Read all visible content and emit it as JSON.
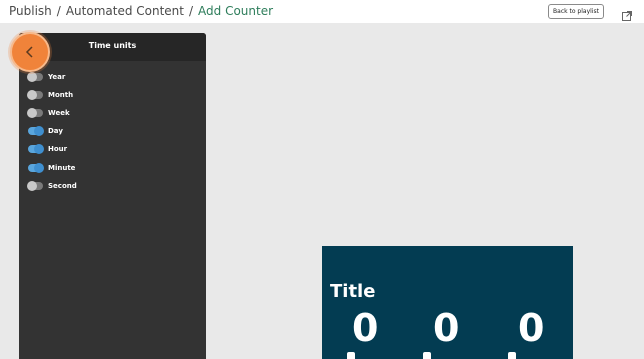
{
  "breadcrumb": {
    "items": [
      "Publish",
      "Automated Content",
      "Add Counter"
    ],
    "separator": "/"
  },
  "header": {
    "back_to_playlist": "Back to playlist",
    "window_icon": "external-window-icon"
  },
  "panel": {
    "title": "Time units",
    "back_icon": "chevron-left-icon",
    "toggles": [
      {
        "label": "Year",
        "on": false
      },
      {
        "label": "Month",
        "on": false
      },
      {
        "label": "Week",
        "on": false
      },
      {
        "label": "Day",
        "on": true
      },
      {
        "label": "Hour",
        "on": true
      },
      {
        "label": "Minute",
        "on": true
      },
      {
        "label": "Second",
        "on": false
      }
    ]
  },
  "preview": {
    "title": "Title",
    "digits": [
      "0",
      "0",
      "0"
    ]
  },
  "colors": {
    "accent_green": "#2e7d5b",
    "panel_bg": "#333333",
    "toggle_on": "#3f8fcf",
    "highlight": "#f0833a",
    "preview_bg": "#033c52"
  }
}
